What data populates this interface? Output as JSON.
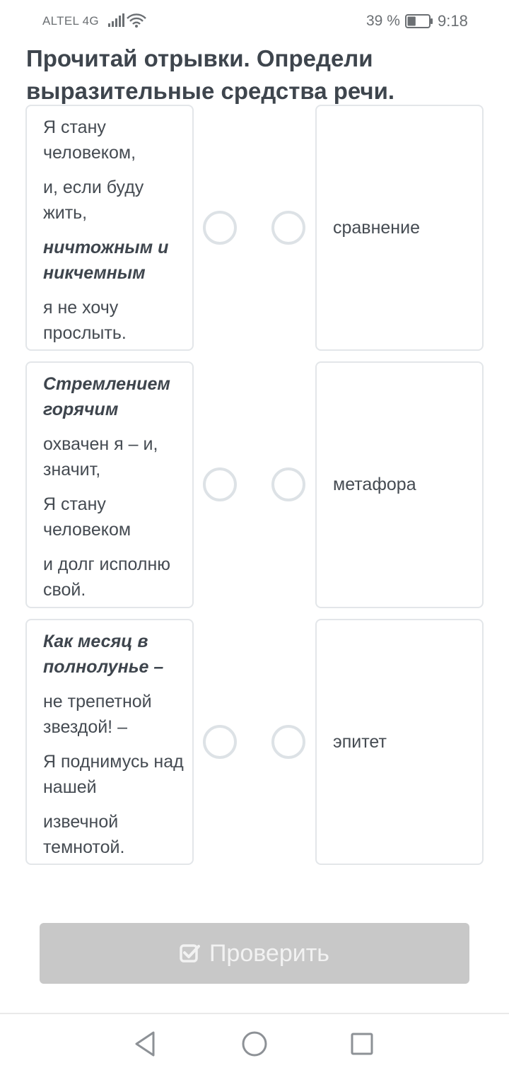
{
  "status_bar": {
    "carrier": "ALTEL 4G",
    "battery_percent": "39 %",
    "battery_level": 0.39,
    "time": "9:18"
  },
  "title": "Прочитай отрывки. Определи выразительные средства речи.",
  "pairs": [
    {
      "excerpt": [
        {
          "text": "Я стану человеком,",
          "emphasis": false
        },
        {
          "text": "и, если буду жить,",
          "emphasis": false
        },
        {
          "text": "ничтожным и никчемным",
          "emphasis": true
        },
        {
          "text": "я не хочу прослыть.",
          "emphasis": false
        }
      ],
      "option": "сравнение"
    },
    {
      "excerpt": [
        {
          "text": "Стремлением горячим",
          "emphasis": true
        },
        {
          "text": "охвачен я – и, значит,",
          "emphasis": false
        },
        {
          "text": "Я стану человеком",
          "emphasis": false
        },
        {
          "text": "и долг исполню свой.",
          "emphasis": false
        }
      ],
      "option": "метафора"
    },
    {
      "excerpt": [
        {
          "text": "Как месяц в полнолунье –",
          "emphasis": true
        },
        {
          "text": "не трепетной звездой! –",
          "emphasis": false
        },
        {
          "text": "Я поднимусь над нашей",
          "emphasis": false
        },
        {
          "text": "извечной темнотой.",
          "emphasis": false
        }
      ],
      "option": "эпитет"
    }
  ],
  "check_button": {
    "label": "Проверить",
    "icon": "checkbox-check-icon"
  },
  "nav": {
    "back_icon": "back-triangle-icon",
    "home_icon": "home-circle-icon",
    "recents_icon": "recents-square-icon"
  },
  "colors": {
    "text": "#3e454d",
    "border": "#e3e6e9",
    "dot": "#dde2e6",
    "button_disabled": "#c8c8c8"
  }
}
